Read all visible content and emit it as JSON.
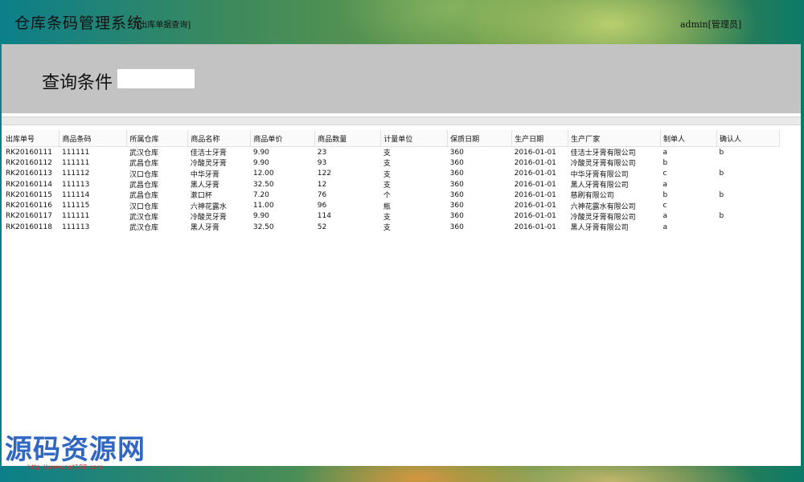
{
  "app": {
    "title": "仓库条码管理系统",
    "subtitle": "-[出库单据查询]",
    "user": "admin[管理员]"
  },
  "query": {
    "label": "查询条件",
    "value": ""
  },
  "table": {
    "columns": [
      "出库单号",
      "商品条码",
      "所属仓库",
      "商品名称",
      "商品单价",
      "商品数量",
      "计量单位",
      "保质日期",
      "生产日期",
      "生产厂家",
      "制单人",
      "确认人"
    ],
    "rows": [
      [
        "RK20160111",
        "111111",
        "武汉仓库",
        "佳洁士牙膏",
        "9.90",
        "23",
        "支",
        "360",
        "2016-01-01",
        "佳洁士牙膏有限公司",
        "a",
        "b"
      ],
      [
        "RK20160112",
        "111111",
        "武昌仓库",
        "冷酸灵牙膏",
        "9.90",
        "93",
        "支",
        "360",
        "2016-01-01",
        "冷酸灵牙膏有限公司",
        "b",
        ""
      ],
      [
        "RK20160113",
        "111112",
        "汉口仓库",
        "中华牙膏",
        "12.00",
        "122",
        "支",
        "360",
        "2016-01-01",
        "中华牙膏有限公司",
        "c",
        "b"
      ],
      [
        "RK20160114",
        "111113",
        "武昌仓库",
        "黑人牙膏",
        "32.50",
        "12",
        "支",
        "360",
        "2016-01-01",
        "黑人牙膏有限公司",
        "a",
        ""
      ],
      [
        "RK20160115",
        "111114",
        "武昌仓库",
        "漱口杯",
        "7.20",
        "76",
        "个",
        "360",
        "2016-01-01",
        "慈刷有限公司",
        "b",
        "b"
      ],
      [
        "RK20160116",
        "111115",
        "汉口仓库",
        "六神花露水",
        "11.00",
        "96",
        "瓶",
        "360",
        "2016-01-01",
        "六神花露水有限公司",
        "c",
        ""
      ],
      [
        "RK20160117",
        "111111",
        "武汉仓库",
        "冷酸灵牙膏",
        "9.90",
        "114",
        "支",
        "360",
        "2016-01-01",
        "冷酸灵牙膏有限公司",
        "a",
        "b"
      ],
      [
        "RK20160118",
        "111113",
        "武汉仓库",
        "黑人牙膏",
        "32.50",
        "52",
        "支",
        "360",
        "2016-01-01",
        "黑人牙膏有限公司",
        "a",
        ""
      ]
    ]
  },
  "watermark": {
    "text": "源码资源网",
    "url": "http://www.net188.com"
  }
}
